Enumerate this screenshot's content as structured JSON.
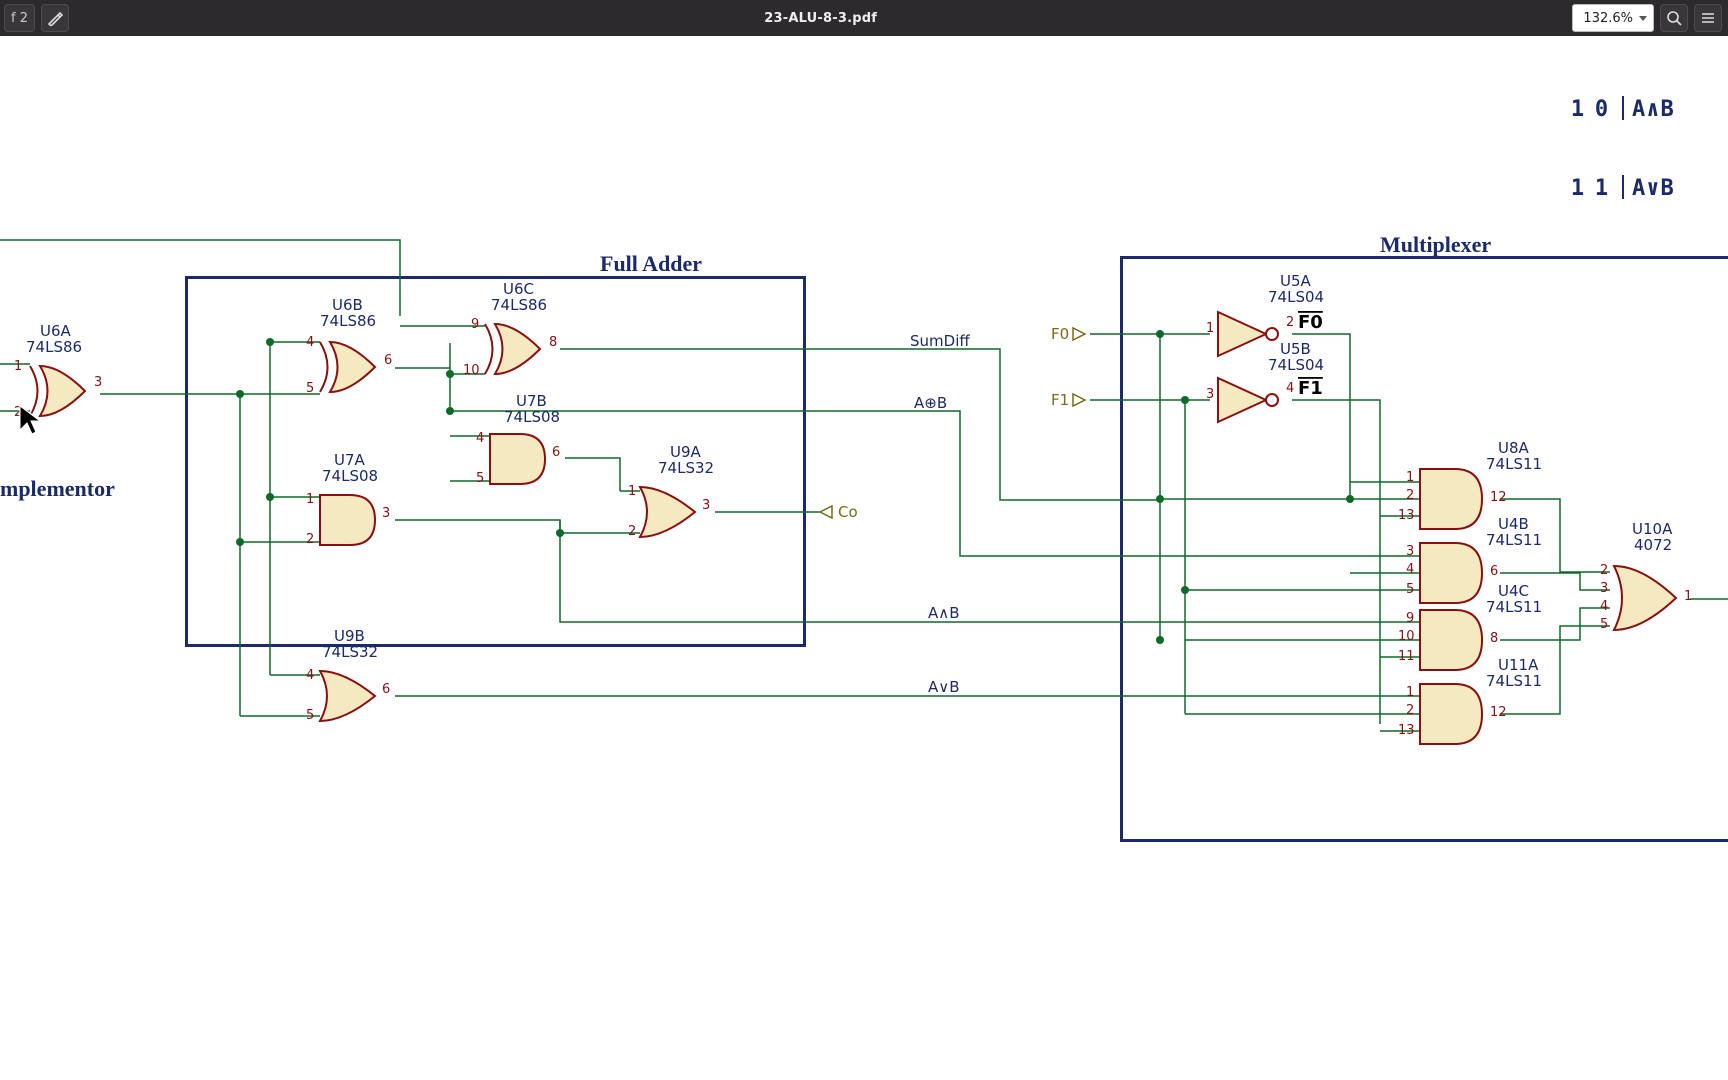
{
  "toolbar": {
    "page_indicator": "f 2",
    "title": "23-ALU-8-3.pdf",
    "zoom": "132.6%"
  },
  "truth_table": {
    "rows": [
      {
        "a": "1",
        "b": "0",
        "fn": "A∧B"
      },
      {
        "a": "1",
        "b": "1",
        "fn": "A∨B"
      }
    ]
  },
  "blocks": {
    "complementor": "mplementor",
    "full_adder": "Full Adder",
    "multiplexer": "Multiplexer"
  },
  "nets": {
    "sumdiff": "SumDiff",
    "axorb": "A⊕B",
    "aandb": "A∧B",
    "aorb": "A∨B",
    "co": "Co",
    "f0": "F0",
    "f1": "F1",
    "f0bar": "F0",
    "f1bar": "F1"
  },
  "gates": {
    "u6a": {
      "ref": "U6A",
      "part": "74LS86",
      "pins": {
        "1": "1",
        "2": "2",
        "3": "3"
      }
    },
    "u6b": {
      "ref": "U6B",
      "part": "74LS86",
      "pins": {
        "4": "4",
        "5": "5",
        "6": "6"
      }
    },
    "u6c": {
      "ref": "U6C",
      "part": "74LS86",
      "pins": {
        "8": "8",
        "9": "9",
        "10": "10"
      }
    },
    "u7a": {
      "ref": "U7A",
      "part": "74LS08",
      "pins": {
        "1": "1",
        "2": "2",
        "3": "3"
      }
    },
    "u7b": {
      "ref": "U7B",
      "part": "74LS08",
      "pins": {
        "4": "4",
        "5": "5",
        "6": "6"
      }
    },
    "u9a": {
      "ref": "U9A",
      "part": "74LS32",
      "pins": {
        "1": "1",
        "2": "2",
        "3": "3"
      }
    },
    "u9b": {
      "ref": "U9B",
      "part": "74LS32",
      "pins": {
        "4": "4",
        "5": "5",
        "6": "6"
      }
    },
    "u5a": {
      "ref": "U5A",
      "part": "74LS04",
      "pins": {
        "1": "1",
        "2": "2"
      }
    },
    "u5b": {
      "ref": "U5B",
      "part": "74LS04",
      "pins": {
        "3": "3",
        "4": "4"
      }
    },
    "u8a": {
      "ref": "U8A",
      "part": "74LS11",
      "pins": {
        "1": "1",
        "2": "2",
        "13": "13",
        "12": "12"
      }
    },
    "u4b": {
      "ref": "U4B",
      "part": "74LS11",
      "pins": {
        "3": "3",
        "4": "4",
        "5": "5",
        "6": "6"
      }
    },
    "u4c": {
      "ref": "U4C",
      "part": "74LS11",
      "pins": {
        "9": "9",
        "10": "10",
        "11": "11",
        "8": "8"
      }
    },
    "u11a": {
      "ref": "U11A",
      "part": "74LS11",
      "pins": {
        "1": "1",
        "2": "2",
        "13": "13",
        "12": "12"
      }
    },
    "u10a": {
      "ref": "U10A",
      "part": "4072",
      "pins": {
        "2": "2",
        "3": "3",
        "4": "4",
        "5": "5",
        "1": "1"
      }
    }
  }
}
